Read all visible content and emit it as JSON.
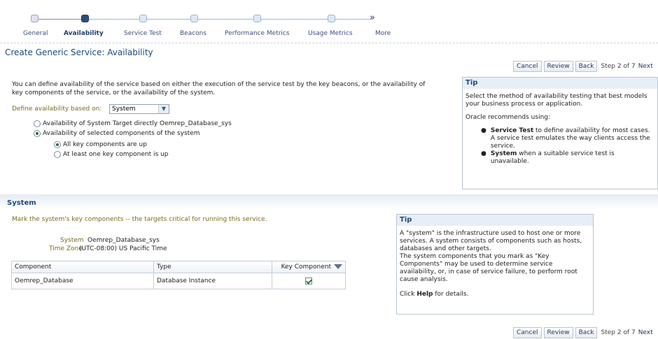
{
  "train": {
    "steps": [
      {
        "label": "General",
        "state": "done"
      },
      {
        "label": "Availability",
        "state": "current"
      },
      {
        "label": "Service Test",
        "state": "todo"
      },
      {
        "label": "Beacons",
        "state": "todo"
      },
      {
        "label": "Performance Metrics",
        "state": "todo"
      },
      {
        "label": "Usage Metrics",
        "state": "todo"
      },
      {
        "label": "More",
        "state": "todo"
      }
    ],
    "more_icon": "double-chevron-right-icon"
  },
  "page_title": "Create Generic Service: Availability",
  "nav": {
    "cancel": "Cancel",
    "review": "Review",
    "back": "Back",
    "step": "Step 2 of 7",
    "next": "Next"
  },
  "availability": {
    "description": "You can define availability of the service based on either the execution of the service test by the key beacons, or the availability of key components of the service, or the availability of the system.",
    "define_label": "Define availability based on:",
    "define_value": "System",
    "options": [
      {
        "label": "Availability of System Target directly Oemrep_Database_sys",
        "selected": false
      },
      {
        "label": "Availability of selected components of the system",
        "selected": true
      }
    ],
    "sub_options": [
      {
        "label": "All key components are up",
        "selected": true
      },
      {
        "label": "At least one key component is up",
        "selected": false
      }
    ]
  },
  "tip1": {
    "title": "Tip",
    "line1": "Select the method of availability testing that best models your business process or application.",
    "line2": "Oracle recommends using:",
    "bullet1_bold": "Service Test",
    "bullet1_text": " to define availability for most cases. A service test emulates the way clients access the service.",
    "bullet2_bold": "System",
    "bullet2_text": " when a suitable service test is unavailable."
  },
  "system_section": {
    "title": "System",
    "instruction": "Mark the system's key components -- the targets critical for running this service.",
    "system_label": "System",
    "system_value": "Oemrep_Database_sys",
    "timezone_label": "Time Zone",
    "timezone_value": "(UTC-08:00) US Pacific Time",
    "table": {
      "headers": [
        "Component",
        "Type",
        "Key Component"
      ],
      "rows": [
        {
          "component": "Oemrep_Database",
          "type": "Database Instance",
          "key": true
        }
      ]
    }
  },
  "tip2": {
    "title": "Tip",
    "text": "A \"system\" is the infrastructure used to host one or more services. A system consists of components such as hosts, databases and other targets.",
    "text2": "The system components that you mark as \"Key Components\" may be used to determine service availability, or, in case of service failure, to perform root cause analysis.",
    "help_pre": "Click ",
    "help_bold": "Help",
    "help_post": " for details."
  }
}
